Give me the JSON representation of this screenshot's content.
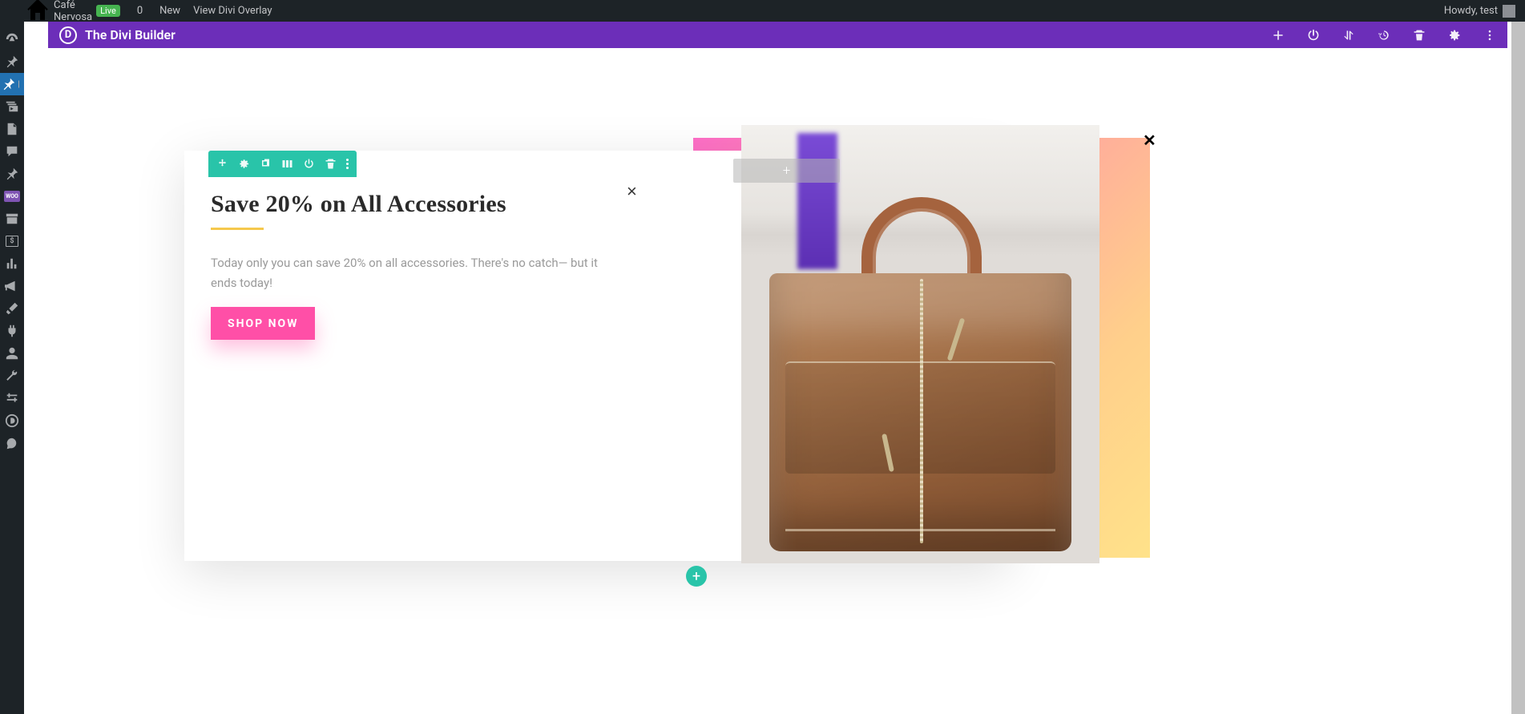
{
  "adminbar": {
    "site_name": "Café Nervosa",
    "live_badge": "Live",
    "comments_count": "0",
    "new_label": "New",
    "view_overlay_label": "View Divi Overlay",
    "greeting": "Howdy, test"
  },
  "divi_bar": {
    "title": "The Divi Builder"
  },
  "popup": {
    "heading": "Save 20% on All Accessories",
    "body": "Today only you can save 20% on all accessories. There's no catch— but it ends today!",
    "cta_label": "Shop Now",
    "close_glyph": "×",
    "close_glyph2": "✕"
  },
  "toolbar_icons": {
    "move": "move",
    "settings": "settings",
    "duplicate": "duplicate",
    "columns": "columns",
    "save": "save",
    "delete": "delete",
    "more": "more",
    "power": "power"
  },
  "placeholders": {
    "add_module_plus": "+",
    "add_section_plus": "+"
  },
  "colors": {
    "divi_purple": "#6c2eb9",
    "section_blue": "#2b87da",
    "row_teal": "#29c4a9",
    "cta_pink": "#ff4fa7",
    "divider_yellow": "#f5c84c"
  }
}
